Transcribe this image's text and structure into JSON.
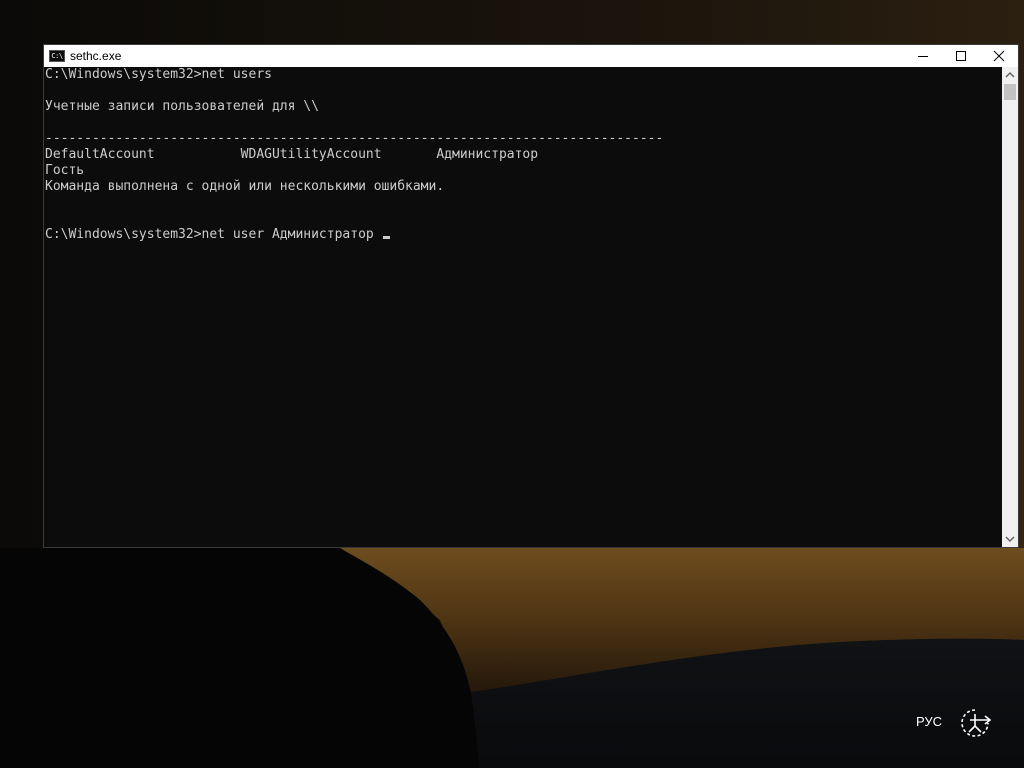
{
  "window": {
    "title": "sethc.exe",
    "icon_text": "C:\\"
  },
  "console": {
    "lines": [
      "C:\\Windows\\system32>net users",
      "",
      "Учетные записи пользователей для \\\\",
      "",
      "-------------------------------------------------------------------------------",
      "DefaultAccount           WDAGUtilityAccount       Администратор",
      "Гость",
      "Команда выполнена с одной или несколькими ошибками.",
      "",
      "",
      "C:\\Windows\\system32>net user Администратор "
    ]
  },
  "tray": {
    "language": "РУС",
    "ease_of_access_icon": "ease-of-access-icon"
  }
}
